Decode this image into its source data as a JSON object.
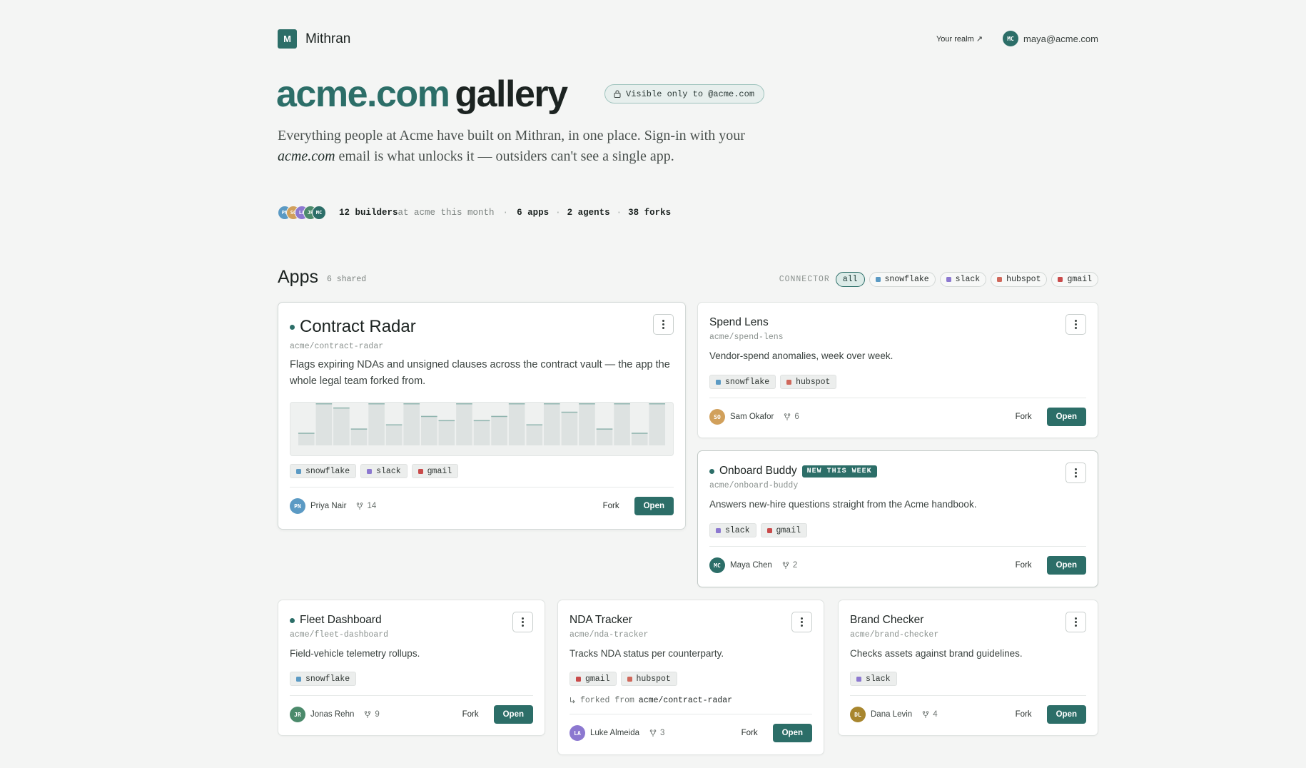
{
  "header": {
    "logo_letter": "M",
    "brand": "Mithran",
    "realm_link": "Your realm ↗",
    "user_initials": "MC",
    "user_email": "maya@acme.com"
  },
  "hero": {
    "title_domain": "acme.com",
    "title_rest": "gallery",
    "visibility": "Visible only to @acme.com",
    "desc_before": "Everything people at Acme have built on Mithran, in one place. Sign-in with your ",
    "desc_em": "acme.com",
    "desc_after": " email is what unlocks it — outsiders can't see a single app."
  },
  "stats": {
    "avatars": [
      {
        "initials": "PN",
        "color": "#5b9ac4"
      },
      {
        "initials": "SO",
        "color": "#d1a05b"
      },
      {
        "initials": "LA",
        "color": "#8c78d0"
      },
      {
        "initials": "JR",
        "color": "#4b8a6b"
      },
      {
        "initials": "MC",
        "color": "#2c6e68"
      }
    ],
    "builders": "12 builders",
    "builders_suffix": " at acme this month",
    "sep1": "·",
    "apps": "6 apps",
    "sep2": "·",
    "agents": "2 agents",
    "sep3": "·",
    "forks": "38 forks"
  },
  "apps_section": {
    "title": "Apps",
    "count": "6 shared",
    "connector_label": "CONNECTOR",
    "filters": [
      {
        "label": "all",
        "color": ""
      },
      {
        "label": "snowflake",
        "color": "#5b9ac4"
      },
      {
        "label": "slack",
        "color": "#8c78d0"
      },
      {
        "label": "hubspot",
        "color": "#d0685b"
      },
      {
        "label": "gmail",
        "color": "#c94a4a"
      }
    ]
  },
  "colors": {
    "snowflake": "#5b9ac4",
    "slack": "#8c78d0",
    "hubspot": "#d0685b",
    "gmail": "#c94a4a",
    "accent": "#2c6e68"
  },
  "cards": [
    {
      "name": "Contract Radar",
      "slug": "acme/contract-radar",
      "desc": "Flags expiring NDAs and unsigned clauses across the contract vault — the app the whole legal team forked from.",
      "tags": [
        "snowflake",
        "slack",
        "gmail"
      ],
      "author": "Priya Nair",
      "initials": "PN",
      "avatar_color": "#5b9ac4",
      "forks": "14",
      "fork_label": "Fork",
      "open_label": "Open",
      "activity": [
        3,
        10,
        9,
        4,
        10,
        5,
        10,
        7,
        6,
        10,
        6,
        7,
        10,
        5,
        10,
        8,
        10,
        4,
        10,
        3,
        10
      ]
    },
    {
      "name": "Spend Lens",
      "slug": "acme/spend-lens",
      "desc": "Vendor-spend anomalies, week over week.",
      "tags": [
        "snowflake",
        "hubspot"
      ],
      "author": "Sam Okafor",
      "initials": "SO",
      "avatar_color": "#d1a05b",
      "forks": "6",
      "fork_label": "Fork",
      "open_label": "Open"
    },
    {
      "name": "Onboard Buddy",
      "badge": "NEW THIS WEEK",
      "slug": "acme/onboard-buddy",
      "desc": "Answers new-hire questions straight from the Acme handbook.",
      "tags": [
        "slack",
        "gmail"
      ],
      "author": "Maya Chen",
      "initials": "MC",
      "avatar_color": "#2c6e68",
      "forks": "2",
      "fork_label": "Fork",
      "open_label": "Open"
    },
    {
      "name": "Fleet Dashboard",
      "slug": "acme/fleet-dashboard",
      "desc": "Field-vehicle telemetry rollups.",
      "tags": [
        "snowflake"
      ],
      "author": "Jonas Rehn",
      "initials": "JR",
      "avatar_color": "#4b8a6b",
      "forks": "9",
      "fork_label": "Fork",
      "open_label": "Open"
    },
    {
      "name": "NDA Tracker",
      "slug": "acme/nda-tracker",
      "desc": "Tracks NDA status per counterparty.",
      "tags": [
        "gmail",
        "hubspot"
      ],
      "forked_prefix": "forked from",
      "forked_from": "acme/contract-radar",
      "author": "Luke Almeida",
      "initials": "LA",
      "avatar_color": "#8c78d0",
      "forks": "3",
      "fork_label": "Fork",
      "open_label": "Open"
    },
    {
      "name": "Brand Checker",
      "slug": "acme/brand-checker",
      "desc": "Checks assets against brand guidelines.",
      "tags": [
        "slack"
      ],
      "author": "Dana Levin",
      "initials": "DL",
      "avatar_color": "#a8862e",
      "forks": "4",
      "fork_label": "Fork",
      "open_label": "Open"
    }
  ]
}
